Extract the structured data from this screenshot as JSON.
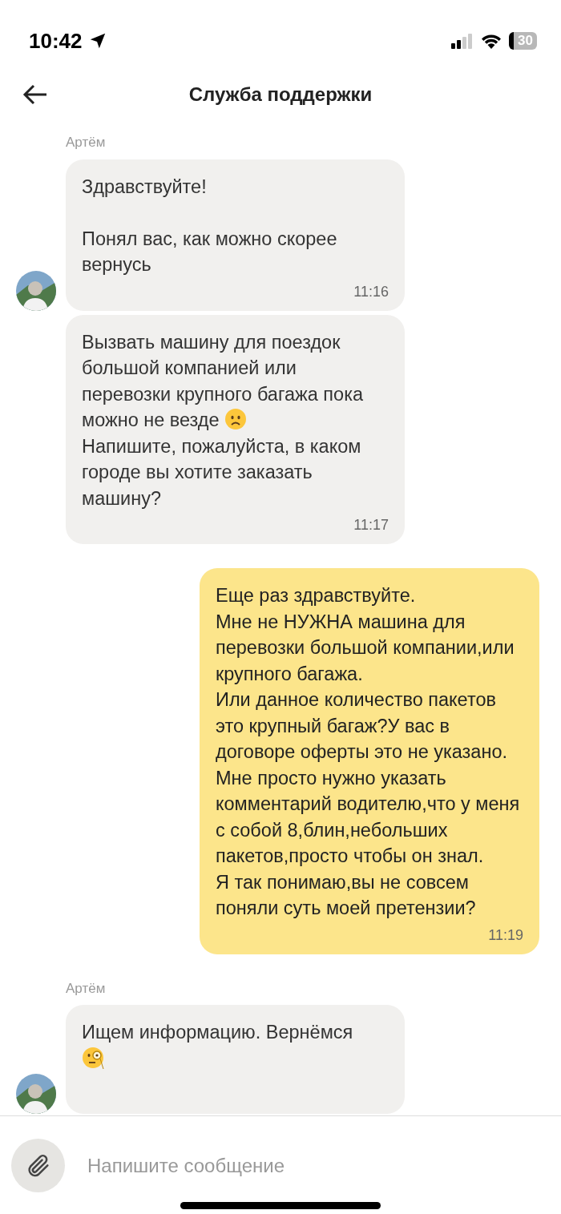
{
  "status_bar": {
    "time": "10:42",
    "battery": "30"
  },
  "header": {
    "title": "Служба поддержки"
  },
  "messages": [
    {
      "kind": "incoming",
      "sender": "Артём",
      "bubbles": [
        {
          "parts": [
            {
              "kind": "text",
              "text": "Здравствуйте!\n\nПонял вас, как можно скорее вернусь"
            }
          ],
          "time": "11:16"
        },
        {
          "parts": [
            {
              "kind": "text",
              "text": "Вызвать машину для поездок большой компанией или перевозки крупного багажа пока можно не везде "
            },
            {
              "kind": "worried-emoji"
            },
            {
              "kind": "text",
              "text": "\nНапишите, пожалуйста, в каком городе вы хотите заказать машину?"
            }
          ],
          "time": "11:17"
        }
      ]
    },
    {
      "kind": "outgoing",
      "bubbles": [
        {
          "parts": [
            {
              "kind": "text",
              "text": "Еще раз здравствуйте.\nМне не НУЖНА машина для перевозки большой компании,или крупного багажа.\nИли данное количество пакетов это крупный багаж?У вас в договоре оферты это не указано.\nМне просто нужно указать комментарий водителю,что у меня с собой 8,блин,небольших пакетов,просто чтобы он знал.\nЯ так понимаю,вы не совсем поняли суть моей претензии?"
            }
          ],
          "time": "11:19"
        }
      ]
    },
    {
      "kind": "incoming",
      "sender": "Артём",
      "bubbles": [
        {
          "parts": [
            {
              "kind": "text",
              "text": "Ищем информацию. Вернёмся\n"
            },
            {
              "kind": "monocle-emoji"
            }
          ]
        }
      ]
    }
  ],
  "composer": {
    "placeholder": "Напишите сообщение"
  }
}
